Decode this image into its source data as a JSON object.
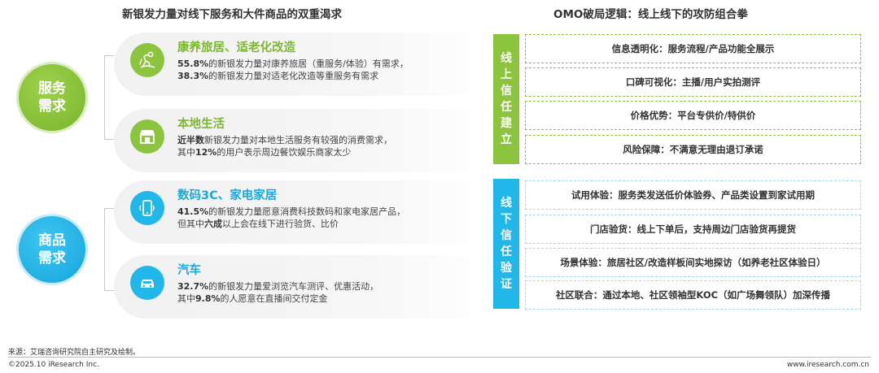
{
  "left_title": "新银发力量对线下服务和大件商品的双重渴求",
  "right_title": "OMO破局逻辑：线上线下的攻防组合拳",
  "groups": {
    "service": {
      "label_1": "服务",
      "label_2": "需求",
      "color": "#8cc43f"
    },
    "product": {
      "label_1": "商品",
      "label_2": "需求",
      "color": "#21b7e8"
    }
  },
  "items": [
    {
      "title": "康养旅居、适老化改造",
      "icon": "elder-travel-icon",
      "line1_bold": "55.8%",
      "line1_rest": "的新银发力量对康养旅居（重服务/体验）有需求，",
      "line2_bold": "38.3%",
      "line2_rest": "的新银发力量对适老化改造等重服务有需求"
    },
    {
      "title": "本地生活",
      "icon": "storefront-icon",
      "line1_bold": "近半数",
      "line1_rest": "新银发力量对本地生活服务有较强的消费需求，",
      "line2_pre": "其中",
      "line2_bold": "12%",
      "line2_rest": "的用户表示周边餐饮娱乐商家太少"
    },
    {
      "title": "数码3C、家电家居",
      "icon": "smartphone-icon",
      "line1_bold": "41.5%",
      "line1_rest": "的新银发力量愿意消费科技数码和家电家居产品，",
      "line2_pre": "但其中",
      "line2_bold": "六成",
      "line2_rest": "以上会在线下进行验货、比价"
    },
    {
      "title": "汽车",
      "icon": "car-icon",
      "line1_bold": "32.7%",
      "line1_rest": "的新银发力量爱浏览汽车测评、优惠活动，",
      "line2_pre": "其中",
      "line2_bold": "9.8%",
      "line2_rest": "的人愿意在直播间交付定金"
    }
  ],
  "online_trust": {
    "label": "线上信任建立",
    "boxes": [
      "信息透明化：服务流程/产品功能全展示",
      "口碑可视化：主播/用户实拍测评",
      "价格优势：平台专供价/特供价",
      "风险保障：不满意无理由退订承诺"
    ]
  },
  "offline_trust": {
    "label": "线下信任验证",
    "boxes": [
      "试用体验：服务类发送低价体验券、产品类设置到家试用期",
      "门店验货：线上下单后，支持周边门店验货再提货",
      "场景体验：旅居社区/改造样板间实地探访（如养老社区体验日）",
      "社区联合：通过本地、社区领袖型KOC（如广场舞领队）加深传播"
    ]
  },
  "footer": {
    "source": "来源：艾瑞咨询研究院自主研究及绘制。",
    "copyright": "©2025.10 iResearch Inc.",
    "website": "www.iresearch.com.cn"
  }
}
